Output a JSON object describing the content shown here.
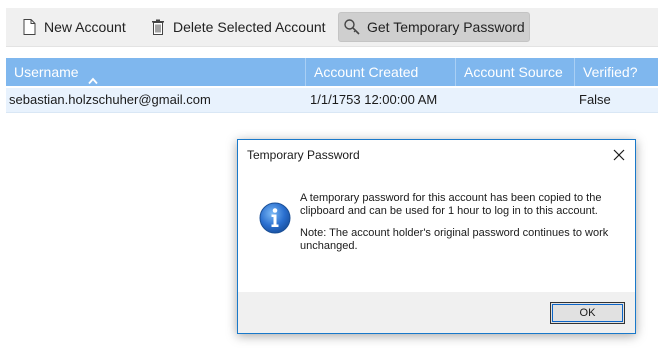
{
  "toolbar": {
    "new_account": "New Account",
    "delete_selected": "Delete Selected Account",
    "get_temp_password": "Get Temporary Password"
  },
  "grid": {
    "columns": [
      "Username",
      "Account Created",
      "Account Source",
      "Verified?"
    ],
    "sort": {
      "column": "Username",
      "direction": "ascending"
    },
    "rows": [
      {
        "username": "sebastian.holzschuher@gmail.com",
        "created": "1/1/1753 12:00:00 AM",
        "source": "",
        "verified": "False"
      }
    ]
  },
  "dialog": {
    "title": "Temporary Password",
    "message_1": "A temporary password for this account has been copied to the clipboard and can be used for 1 hour to log in to this account.",
    "message_2": "Note: The account holder's original password continues to work unchanged.",
    "ok_label": "OK",
    "icon": "info-icon"
  },
  "colors": {
    "header_bg": "#7fb7ee",
    "row_selected": "#e8f2fd",
    "dialog_border": "#1979ca"
  }
}
